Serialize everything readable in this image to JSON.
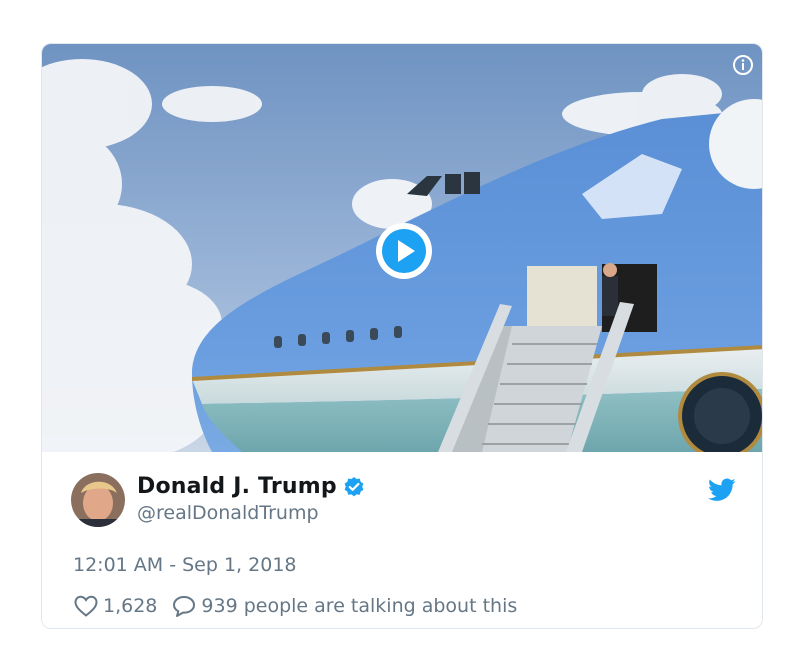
{
  "tweet": {
    "display_name": "Donald J. Trump",
    "handle": "@realDonaldTrump",
    "timestamp": "12:01 AM - Sep 1, 2018",
    "like_count": "1,628",
    "conversation_text": "939 people are talking about this",
    "verified": true
  },
  "media": {
    "type": "video",
    "play_icon": "play-circle-icon",
    "info_icon": "info-circle-icon"
  },
  "icons": {
    "brand": "twitter-bird-icon",
    "verified": "verified-badge-icon",
    "like": "heart-outline-icon",
    "reply": "speech-bubble-icon"
  },
  "colors": {
    "twitter_blue": "#1da1f2",
    "name_text": "#14171a",
    "secondary_text": "#657786",
    "card_border": "#e1e8ed"
  }
}
